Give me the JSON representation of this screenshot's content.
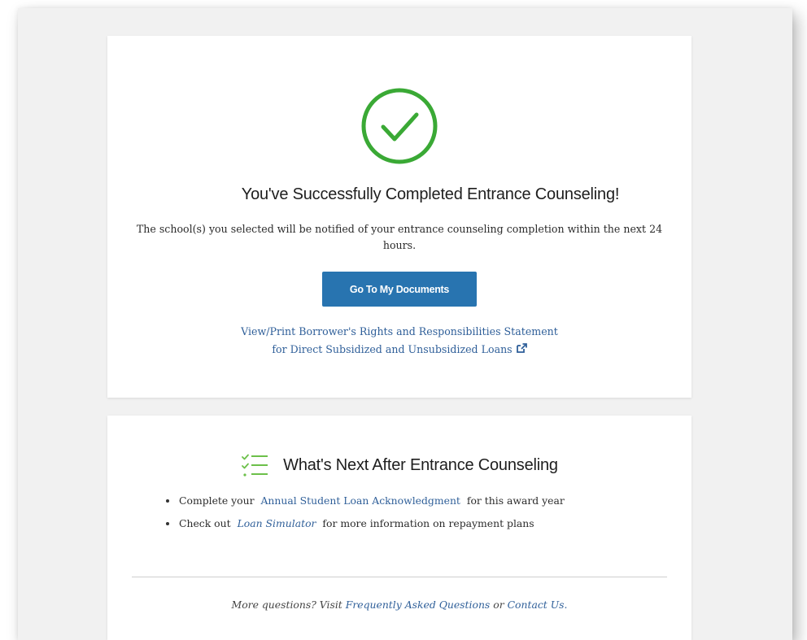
{
  "success": {
    "title": "You've Successfully Completed Entrance Counseling!",
    "notice": "The school(s) you selected will be notified of your entrance counseling completion within the next 24 hours.",
    "button_label": "Go To My Documents",
    "rights_link_line1": "View/Print Borrower's Rights and Responsibilities Statement",
    "rights_link_line2": "for Direct Subsidized and Unsubsidized Loans"
  },
  "next": {
    "title": "What's Next After Entrance Counseling",
    "items": [
      {
        "prefix": "Complete your",
        "link": "Annual Student Loan Acknowledgment",
        "suffix": "for this award year"
      },
      {
        "prefix": "Check out",
        "link": "Loan Simulator",
        "suffix": "for more information on repayment plans"
      }
    ]
  },
  "footer": {
    "prefix": "More questions? Visit",
    "faq_link": "Frequently Asked Questions",
    "middle": "or",
    "contact_link": "Contact Us."
  },
  "icons": {
    "success": "check-circle-icon",
    "list": "checklist-icon",
    "external": "external-link-icon"
  },
  "colors": {
    "success_green": "#3aa935",
    "button_blue": "#2874b0",
    "link_blue": "#2f5f99",
    "list_icon_green": "#6cc04a"
  }
}
